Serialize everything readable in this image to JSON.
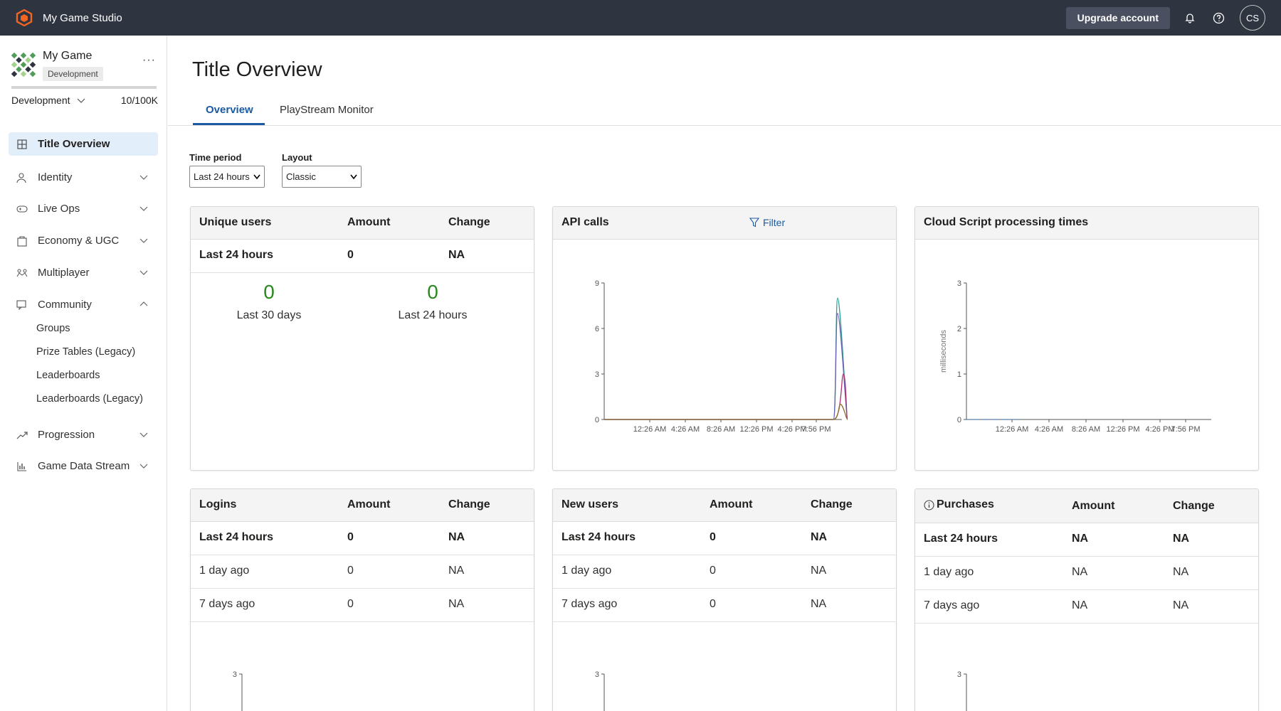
{
  "topbar": {
    "studio_name": "My Game Studio",
    "upgrade_label": "Upgrade account",
    "avatar_initials": "CS",
    "icons": [
      "playfab-logo-icon",
      "bell-icon",
      "help-icon"
    ],
    "brand_color": "#f26522"
  },
  "sidebar": {
    "game_name": "My Game",
    "game_badge": "Development",
    "more_label": "···",
    "environment": "Development",
    "usage": "10/100K",
    "usage_fraction": 0.0001,
    "items": [
      {
        "label": "Title Overview",
        "icon": "dashboard-icon",
        "active": true
      },
      {
        "label": "Identity",
        "icon": "identity-icon"
      },
      {
        "label": "Live Ops",
        "icon": "gamepad-icon"
      },
      {
        "label": "Economy & UGC",
        "icon": "bag-icon"
      },
      {
        "label": "Multiplayer",
        "icon": "people-icon"
      },
      {
        "label": "Community",
        "icon": "chat-icon",
        "expanded": true
      },
      {
        "label": "Progression",
        "icon": "trend-icon"
      },
      {
        "label": "Game Data Stream",
        "icon": "bar-chart-icon"
      }
    ],
    "community_children": [
      "Groups",
      "Prize Tables (Legacy)",
      "Leaderboards",
      "Leaderboards (Legacy)"
    ]
  },
  "main": {
    "title": "Title Overview",
    "tabs": [
      "Overview",
      "PlayStream Monitor"
    ],
    "time_period_label": "Time period",
    "time_period_value": "Last 24 hours",
    "layout_label": "Layout",
    "layout_value": "Classic"
  },
  "cards": {
    "unique_users": {
      "title": "Unique users",
      "col_amount": "Amount",
      "col_change": "Change",
      "row_label": "Last 24 hours",
      "row_amount": "0",
      "row_change": "NA",
      "big1_value": "0",
      "big1_label": "Last 30 days",
      "big2_value": "0",
      "big2_label": "Last 24 hours"
    },
    "api_calls": {
      "title": "API calls",
      "filter_label": "Filter"
    },
    "cloud_script": {
      "title": "Cloud Script processing times"
    },
    "logins": {
      "title": "Logins",
      "col_amount": "Amount",
      "col_change": "Change",
      "rows": [
        {
          "label": "Last 24 hours",
          "amount": "0",
          "change": "NA"
        },
        {
          "label": "1 day ago",
          "amount": "0",
          "change": "NA"
        },
        {
          "label": "7 days ago",
          "amount": "0",
          "change": "NA"
        }
      ]
    },
    "new_users": {
      "title": "New users",
      "col_amount": "Amount",
      "col_change": "Change",
      "rows": [
        {
          "label": "Last 24 hours",
          "amount": "0",
          "change": "NA"
        },
        {
          "label": "1 day ago",
          "amount": "0",
          "change": "NA"
        },
        {
          "label": "7 days ago",
          "amount": "0",
          "change": "NA"
        }
      ]
    },
    "purchases": {
      "title": "Purchases",
      "col_amount": "Amount",
      "col_change": "Change",
      "rows": [
        {
          "label": "Last 24 hours",
          "amount": "NA",
          "change": "NA"
        },
        {
          "label": "1 day ago",
          "amount": "NA",
          "change": "NA"
        },
        {
          "label": "7 days ago",
          "amount": "NA",
          "change": "NA"
        }
      ]
    }
  },
  "chart_data": [
    {
      "type": "line",
      "title": "API calls",
      "x": [
        "12:26 AM",
        "4:26 AM",
        "8:26 AM",
        "12:26 PM",
        "4:26 PM",
        "7:56 PM"
      ],
      "ylim": [
        0,
        9
      ],
      "yticks": [
        "0",
        "3",
        "6",
        "9"
      ],
      "series": [
        {
          "color": "#2a9d8f",
          "peak": 8.0
        },
        {
          "color": "#6c63b5",
          "peak": 7.0
        },
        {
          "color": "#b0306e",
          "peak": 3.0
        },
        {
          "color": "#8c6b2c",
          "peak": 1.0
        }
      ]
    },
    {
      "type": "line",
      "title": "Cloud Script processing times",
      "ylabel": "milliseconds",
      "x": [
        "12:26 AM",
        "4:26 AM",
        "8:26 AM",
        "12:26 PM",
        "4:26 PM",
        "7:56 PM"
      ],
      "ylim": [
        0,
        3
      ],
      "yticks": [
        "0",
        "1",
        "2",
        "3"
      ]
    },
    {
      "type": "line",
      "title": "Logins",
      "yticks": [
        "3"
      ]
    },
    {
      "type": "line",
      "title": "New users",
      "yticks": [
        "3"
      ]
    },
    {
      "type": "line",
      "title": "Purchases",
      "yticks": [
        "3"
      ]
    }
  ]
}
